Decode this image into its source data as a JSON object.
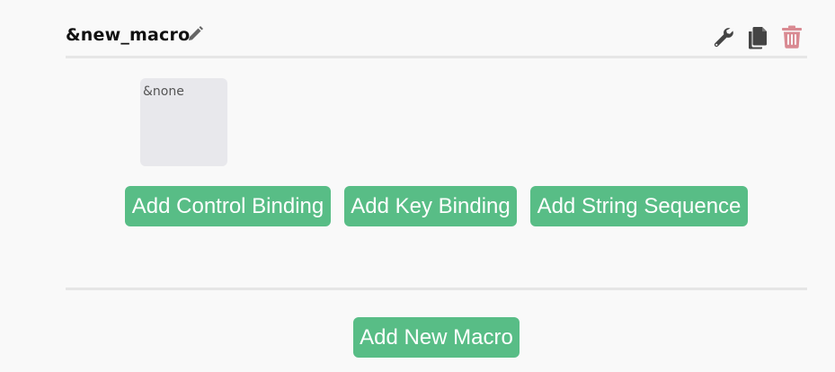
{
  "macro": {
    "name": "&new_macro",
    "icons": {
      "edit": "pencil-icon",
      "configure": "wrench-icon",
      "copy": "copy-icon",
      "delete": "trash-icon"
    }
  },
  "bindings": [
    {
      "label": "&none"
    }
  ],
  "actions": {
    "add_control_binding": "Add Control Binding",
    "add_key_binding": "Add Key Binding",
    "add_string_sequence": "Add String Sequence"
  },
  "footer": {
    "add_new_macro": "Add New Macro"
  },
  "colors": {
    "button_green": "#58bd86",
    "delete_red": "#d98a92",
    "icon_gray": "#555555"
  }
}
